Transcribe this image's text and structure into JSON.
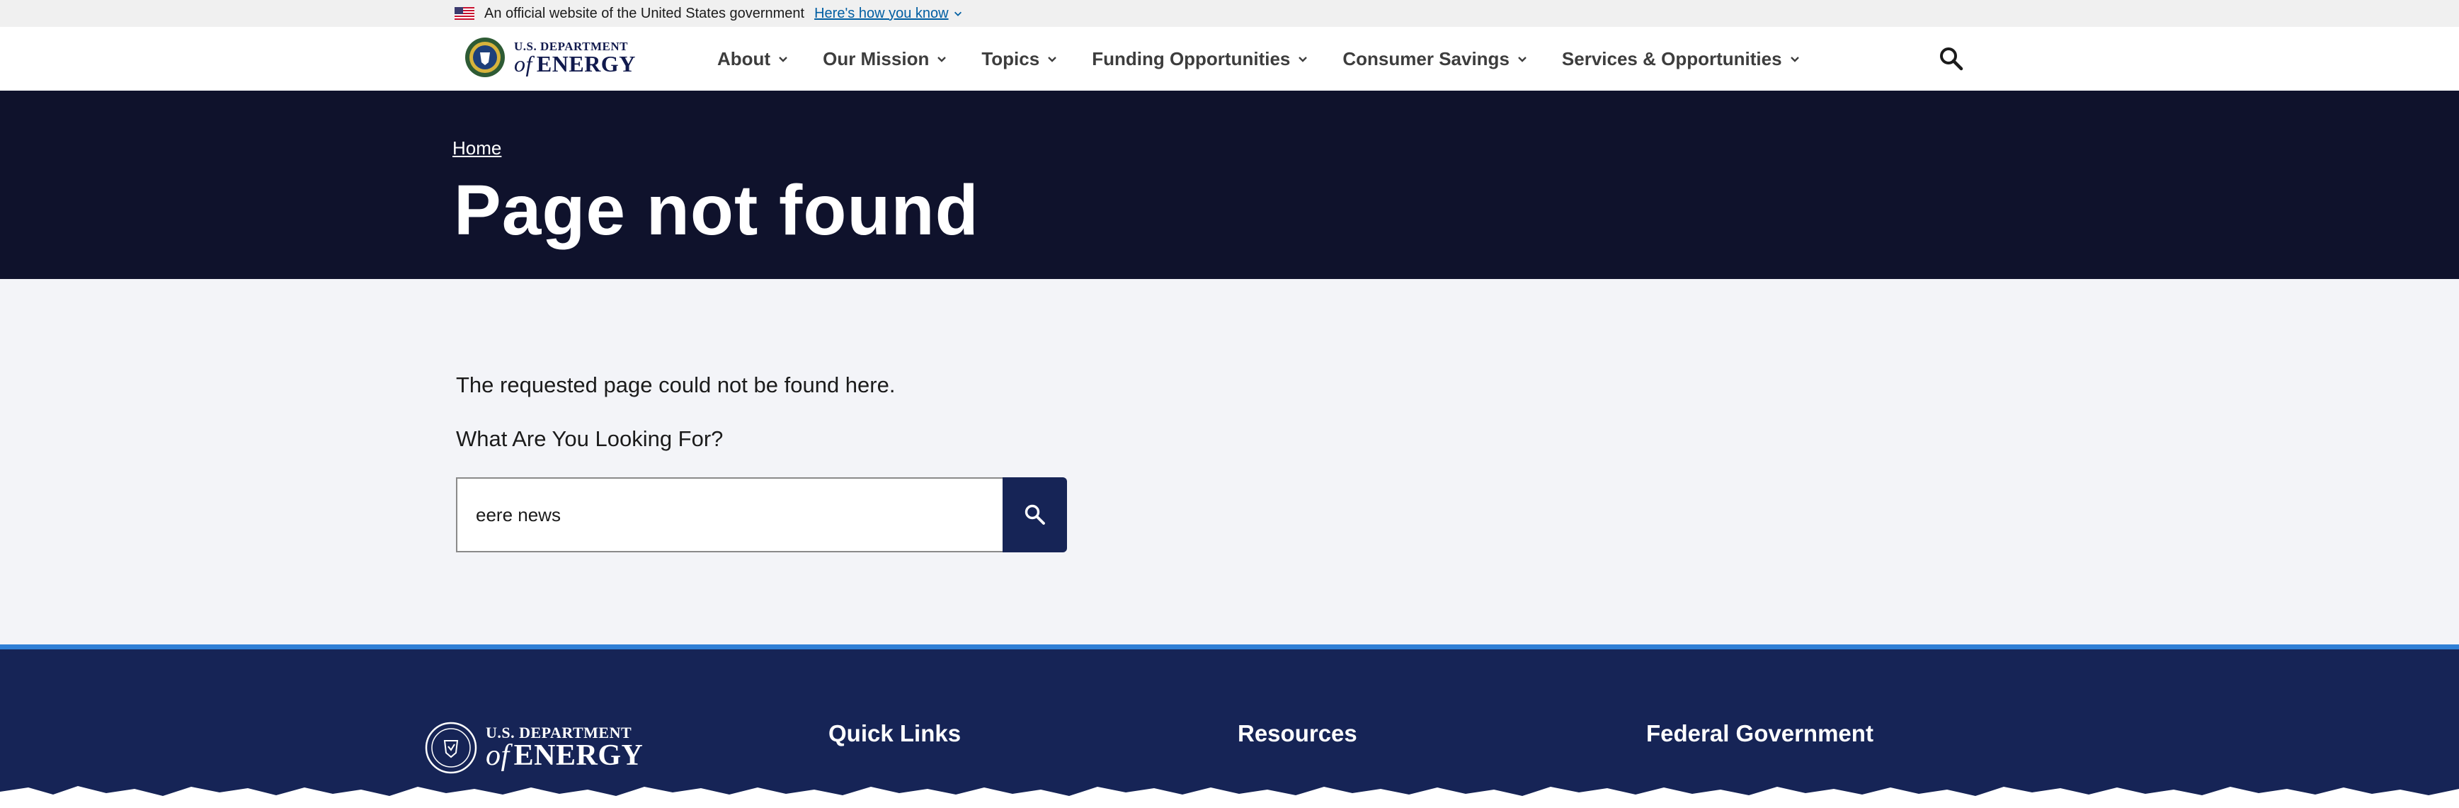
{
  "gov_banner": {
    "text": "An official website of the United States government",
    "link": "Here's how you know"
  },
  "header": {
    "logo_top": "U.S. DEPARTMENT",
    "logo_of": "of",
    "logo_bottom": "ENERGY",
    "nav": [
      {
        "label": "About"
      },
      {
        "label": "Our Mission"
      },
      {
        "label": "Topics"
      },
      {
        "label": "Funding Opportunities"
      },
      {
        "label": "Consumer Savings"
      },
      {
        "label": "Services & Opportunities"
      }
    ],
    "search_icon": "search-icon"
  },
  "hero": {
    "breadcrumb": "Home",
    "title": "Page not found"
  },
  "main": {
    "message": "The requested page could not be found here.",
    "prompt": "What Are You Looking For?",
    "search_value": "eere news",
    "search_icon": "search-icon"
  },
  "footer": {
    "logo_top": "U.S. DEPARTMENT",
    "logo_of": "of",
    "logo_bottom": "ENERGY",
    "columns": [
      {
        "heading": "Quick Links"
      },
      {
        "heading": "Resources"
      },
      {
        "heading": "Federal Government"
      }
    ]
  },
  "colors": {
    "hero_bg": "#0f122c",
    "footer_bg": "#162456",
    "accent": "#2f7fd6",
    "main_bg": "#f3f4f8"
  }
}
